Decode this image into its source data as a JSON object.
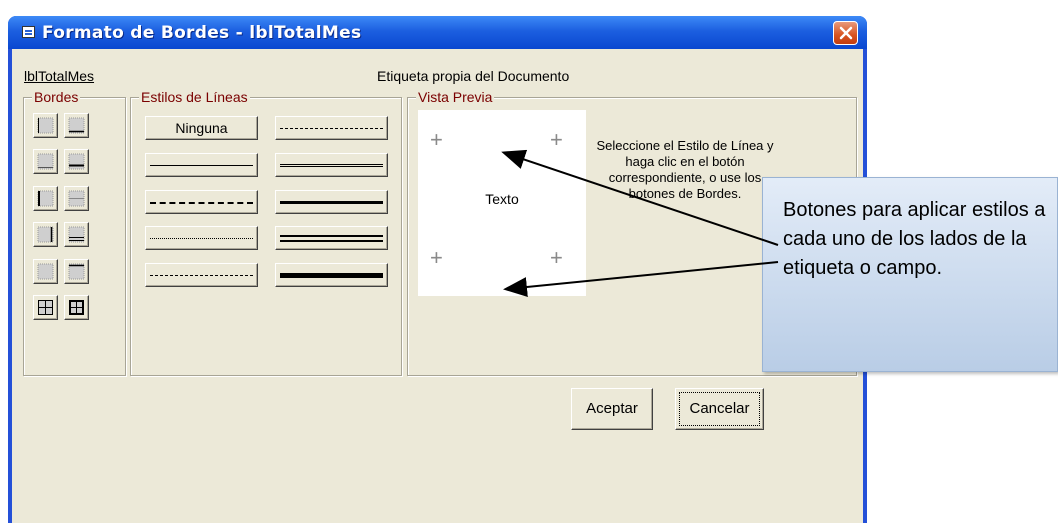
{
  "window": {
    "title": "Formato de Bordes - lblTotalMes",
    "close_icon": "close-x-icon"
  },
  "header": {
    "control_name": "lblTotalMes",
    "control_type": "Etiqueta propia del Documento"
  },
  "groups": {
    "bordes": "Bordes",
    "estilos": "Estilos de Líneas",
    "vista_previa": "Vista Previa"
  },
  "border_buttons": [
    "border-left-icon",
    "border-bottom-icon",
    "border-top-icon",
    "border-bottom-thin-icon",
    "border-left-right-icon",
    "border-inner-icon",
    "border-right-icon",
    "border-double-bottom-icon",
    "border-top-bottom-icon",
    "border-bottom-thick-icon",
    "border-all-icon",
    "border-box-icon"
  ],
  "line_styles": {
    "none_label": "Ninguna",
    "styles": [
      "none",
      "dash-dot",
      "thin",
      "double",
      "dashed",
      "thick",
      "dotted",
      "double-thick",
      "dash-dot-long",
      "thick-heavy"
    ]
  },
  "preview": {
    "text": "Texto",
    "instructions": "Seleccione el Estilo de Línea y haga clic en el botón correspondiente, o use los botones de Bordes."
  },
  "buttons": {
    "ok": "Aceptar",
    "cancel": "Cancelar"
  },
  "callout": {
    "text": "Botones para aplicar estilos a cada uno de los lados de la etiqueta o campo."
  },
  "colors": {
    "title_bar": "#0a47d0",
    "dialog_bg": "#ece9d8",
    "legend_text": "#7a0000",
    "callout_bg": "#c9d9ee"
  }
}
